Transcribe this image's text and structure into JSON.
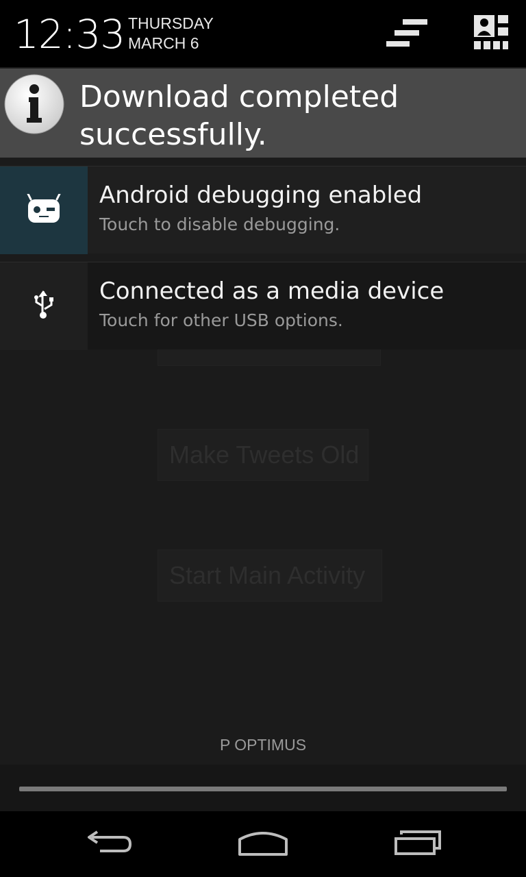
{
  "header": {
    "time": "12:33",
    "weekday": "THURSDAY",
    "date": "MARCH 6",
    "clear_icon": "clear-all-icon",
    "settings_icon": "quick-settings-icon"
  },
  "ticker": {
    "icon": "info-icon",
    "text": "Download completed successfully."
  },
  "notifications": [
    {
      "icon": "cyanogenmod-bugdroid-icon",
      "title": "Android debugging enabled",
      "subtitle": "Touch to disable debugging."
    },
    {
      "icon": "usb-icon",
      "title": "Connected as a media device",
      "subtitle": "Touch for other USB options."
    }
  ],
  "background_app": {
    "buttons": [
      "Make Tweets Old",
      "Start Main Activity"
    ]
  },
  "carrier": "P OPTIMUS",
  "navbar": {
    "back_icon": "back-icon",
    "home_icon": "home-icon",
    "recents_icon": "recents-icon"
  }
}
